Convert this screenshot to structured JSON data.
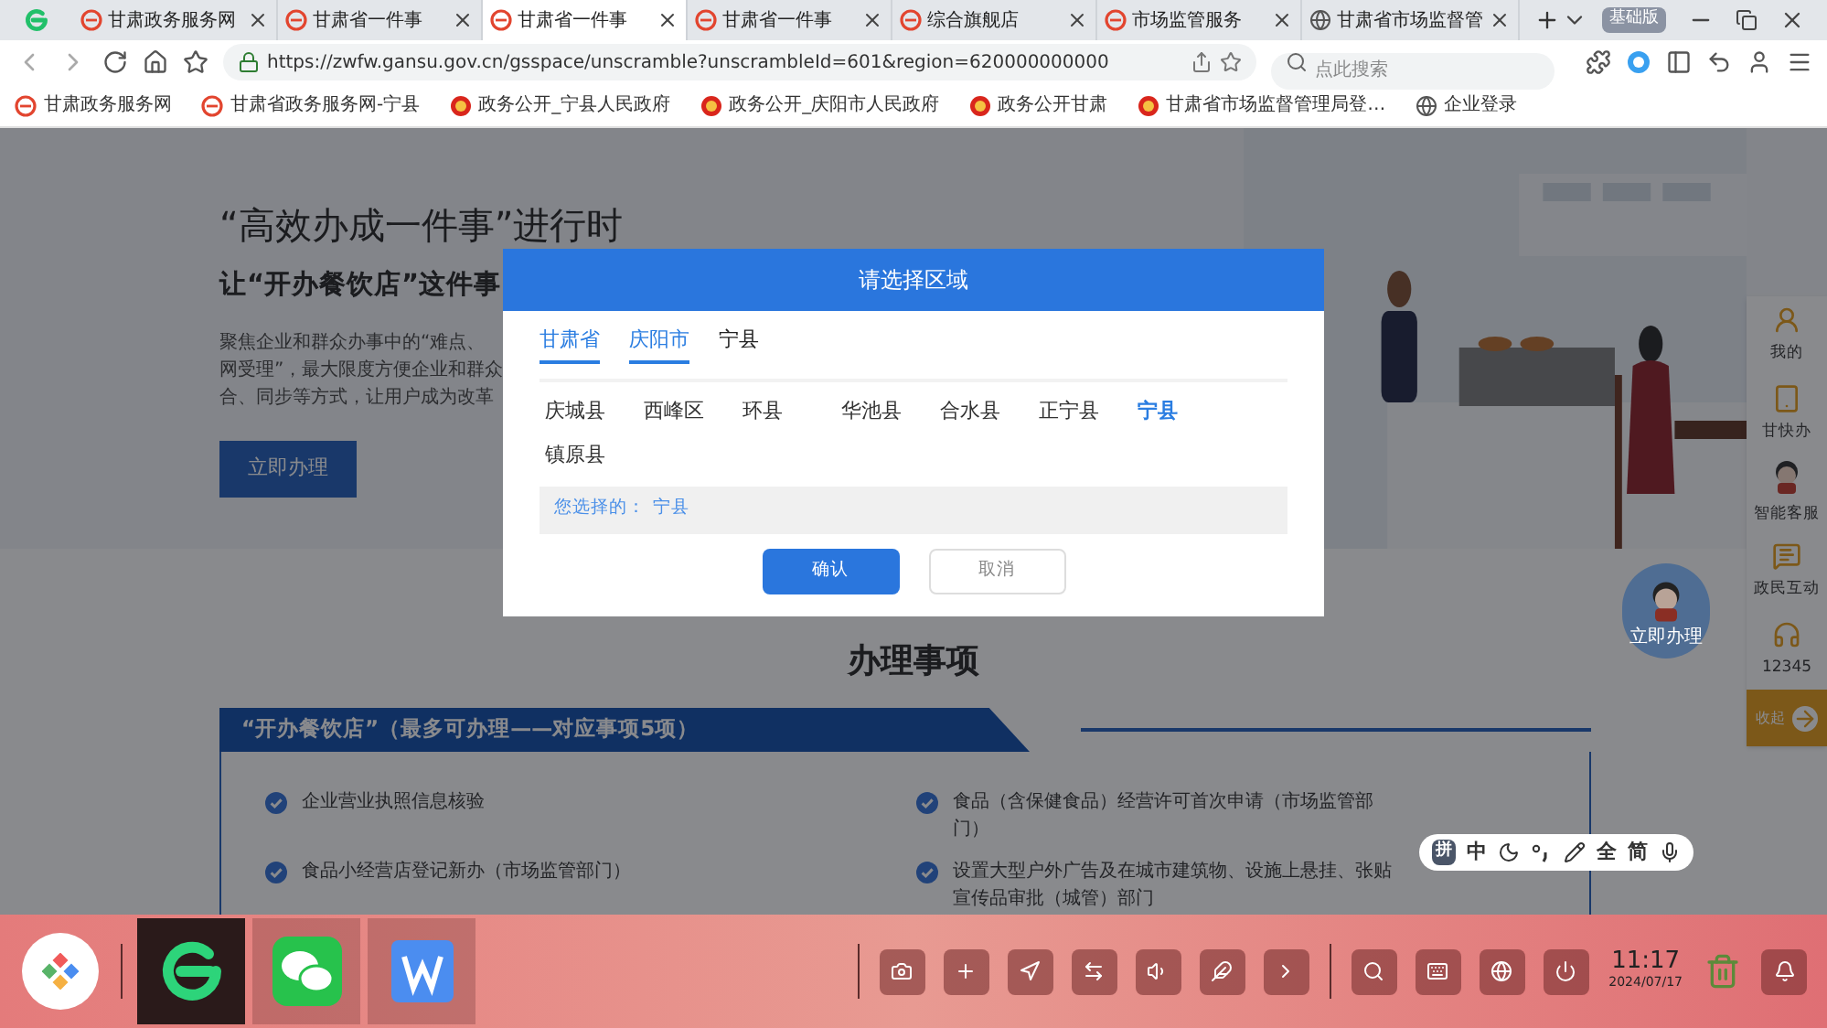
{
  "browser": {
    "tabs": [
      {
        "title": "甘肃政务服务网",
        "selected": false,
        "kind": "site"
      },
      {
        "title": "甘肃省一件事",
        "selected": false,
        "kind": "site"
      },
      {
        "title": "甘肃省一件事",
        "selected": true,
        "kind": "site"
      },
      {
        "title": "甘肃省一件事",
        "selected": false,
        "kind": "site"
      },
      {
        "title": "综合旗舰店",
        "selected": false,
        "kind": "site"
      },
      {
        "title": "市场监管服务",
        "selected": false,
        "kind": "site"
      },
      {
        "title": "甘肃省市场监督管",
        "selected": false,
        "kind": "globe"
      }
    ],
    "version_badge": "基础版",
    "address": "https://zwfw.gansu.gov.cn/gsspace/unscramble?unscrambleId=601&region=620000000000",
    "search": {
      "placeholder": "点此搜索"
    },
    "bookmarks": [
      {
        "label": "甘肃政务服务网",
        "kind": "site"
      },
      {
        "label": "甘肃省政务服务网-宁县",
        "kind": "site"
      },
      {
        "label": "政务公开_宁县人民政府",
        "kind": "emblem"
      },
      {
        "label": "政务公开_庆阳市人民政府",
        "kind": "emblem"
      },
      {
        "label": "政务公开甘肃",
        "kind": "emblem"
      },
      {
        "label": "甘肃省市场监督管理局登…",
        "kind": "emblem"
      },
      {
        "label": "企业登录",
        "kind": "globe"
      }
    ]
  },
  "page": {
    "hero": {
      "title": "“高效办成一件事”进行时",
      "subtitle": "让“开办餐饮店”这件事",
      "description": [
        "聚焦企业和群众办事中的“难点、",
        "网受理”，最大限度方便企业和群众",
        "合、同步等方式，让用户成为改革"
      ],
      "button": "立即办理"
    },
    "mascot_label": "立即办理",
    "sidebar": {
      "items": [
        {
          "label": "我的",
          "kind": "user"
        },
        {
          "label": "甘快办",
          "kind": "tablet"
        },
        {
          "label": "智能客服",
          "kind": "mascot"
        },
        {
          "label": "政民互动",
          "kind": "chat"
        },
        {
          "label": "12345",
          "kind": "headset"
        }
      ],
      "collapse": "收起"
    },
    "section": {
      "heading": "办理事项",
      "banner": "“开办餐饮店”（最多可办理——对应事项5项）",
      "items": [
        "企业营业执照信息核验",
        "食品（含保健食品）经营许可首次申请（市场监管部门）",
        "食品小经营店登记新办（市场监管部门）",
        "设置大型户外广告及在城市建筑物、设施上悬挂、张贴宣传品审批（城管）部门"
      ]
    }
  },
  "dialog": {
    "title": "请选择区域",
    "path": [
      {
        "label": "甘肃省",
        "active": true
      },
      {
        "label": "庆阳市",
        "active": true
      },
      {
        "label": "宁县",
        "active": false
      }
    ],
    "options": [
      {
        "label": "庆城县",
        "selected": false
      },
      {
        "label": "西峰区",
        "selected": false
      },
      {
        "label": "环县",
        "selected": false
      },
      {
        "label": "华池县",
        "selected": false
      },
      {
        "label": "合水县",
        "selected": false
      },
      {
        "label": "正宁县",
        "selected": false
      },
      {
        "label": "宁县",
        "selected": true
      },
      {
        "label": "镇原县",
        "selected": false
      }
    ],
    "chosen_label": "您选择的：",
    "chosen_value": "宁县",
    "buttons": [
      {
        "label": "确认",
        "kind": "primary"
      },
      {
        "label": "取消",
        "kind": "secondary"
      }
    ]
  },
  "ime_toolbar": [
    "拼",
    "中",
    "全",
    "简"
  ],
  "taskbar": {
    "apps": [
      {
        "kind": "browser",
        "selected": true
      },
      {
        "kind": "chat",
        "selected": false
      },
      {
        "kind": "writer",
        "selected": false
      }
    ],
    "time": "11:17",
    "date": "2024/07/17"
  }
}
